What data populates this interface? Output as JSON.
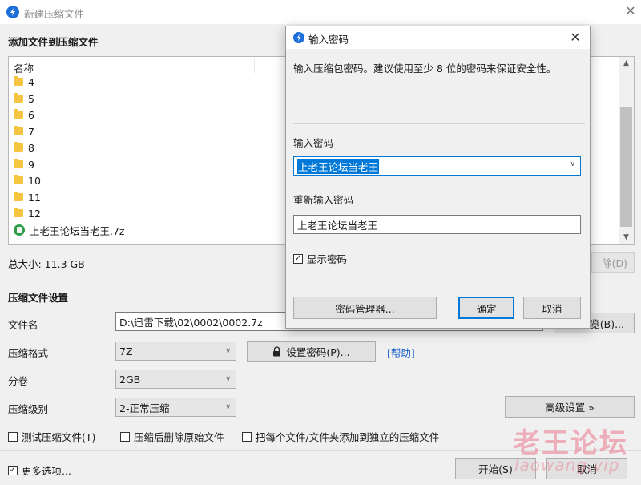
{
  "window": {
    "title": "新建压缩文件",
    "close_glyph": "✕",
    "icon": "bandizip-app-icon"
  },
  "add_section": {
    "title": "添加文件到压缩文件"
  },
  "file_list": {
    "header_name": "名称",
    "items": [
      {
        "name": "4",
        "icon": "folder-icon"
      },
      {
        "name": "5",
        "icon": "folder-icon"
      },
      {
        "name": "6",
        "icon": "folder-icon"
      },
      {
        "name": "7",
        "icon": "folder-icon"
      },
      {
        "name": "8",
        "icon": "folder-icon"
      },
      {
        "name": "9",
        "icon": "folder-icon"
      },
      {
        "name": "10",
        "icon": "folder-icon"
      },
      {
        "name": "11",
        "icon": "folder-icon"
      },
      {
        "name": "12",
        "icon": "folder-icon"
      },
      {
        "name": "上老王论坛当老王.7z",
        "icon": "archive-icon"
      }
    ]
  },
  "total_size": "总大小: 11.3 GB",
  "delete_button_partial": "除(D)",
  "settings": {
    "title": "压缩文件设置",
    "filename_label": "文件名",
    "filename_value": "D:\\迅雷下载\\02\\0002\\0002.7z",
    "browse_button_partial": "览(B)...",
    "format_label": "压缩格式",
    "format_value": "7Z",
    "set_password_button": "设置密码(P)...",
    "help_link": "[帮助]",
    "split_label": "分卷",
    "split_value": "2GB",
    "level_label": "压缩级别",
    "level_value": "2-正常压缩",
    "advanced_button": "高级设置 »"
  },
  "options": {
    "test_archive": {
      "label": "测试压缩文件(T)",
      "checked": false
    },
    "delete_after": {
      "label": "压缩后删除原始文件",
      "checked": false
    },
    "separate_archives": {
      "label": "把每个文件/文件夹添加到独立的压缩文件",
      "checked": false
    },
    "more_options": {
      "label": "更多选项...",
      "checked": true
    }
  },
  "footer": {
    "start_button": "开始(S)",
    "cancel_button_partial": "取消"
  },
  "dialog": {
    "title": "输入密码",
    "close_glyph": "✕",
    "description": "输入压缩包密码。建议使用至少 8 位的密码来保证安全性。",
    "password_label": "输入密码",
    "password_value": "上老王论坛当老王",
    "reenter_label": "重新输入密码",
    "reenter_value": "上老王论坛当老王",
    "show_password": {
      "label": "显示密码",
      "checked": true
    },
    "manager_button": "密码管理器...",
    "ok_button": "确定",
    "cancel_button": "取消"
  },
  "watermark": {
    "text": "老王论坛",
    "sub": "laowang.vip"
  },
  "colors": {
    "accent": "#0078d7",
    "app_icon": "#1e6fd9",
    "folder": "#f5c542",
    "link": "#1a5fc8"
  }
}
